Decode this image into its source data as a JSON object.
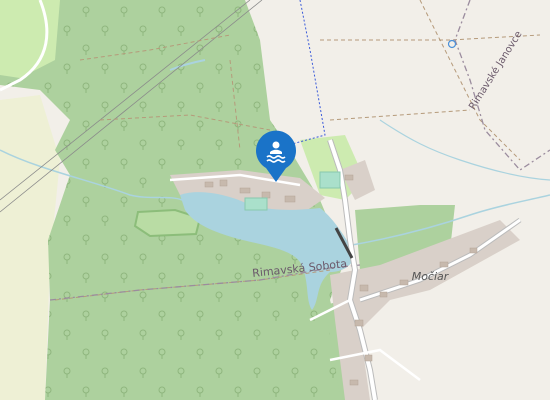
{
  "map": {
    "labels": {
      "boundary_municipality": "Rimavská Sobota",
      "village": "Močiar",
      "municipality_ne": "Rimavské Janovce"
    },
    "poi": {
      "type": "swimming-area",
      "icon": "swimmer-icon",
      "color": "#1a73c8"
    },
    "colors": {
      "land": "#f2efe9",
      "forest": "#add19e",
      "meadow": "#cdebb0",
      "water": "#aad3df",
      "residential": "#d9d0c9",
      "road": "#ffffff",
      "road_casing": "#bbbbbb",
      "boundary": "#9b8c9e",
      "farmland": "#eef0d5"
    }
  }
}
